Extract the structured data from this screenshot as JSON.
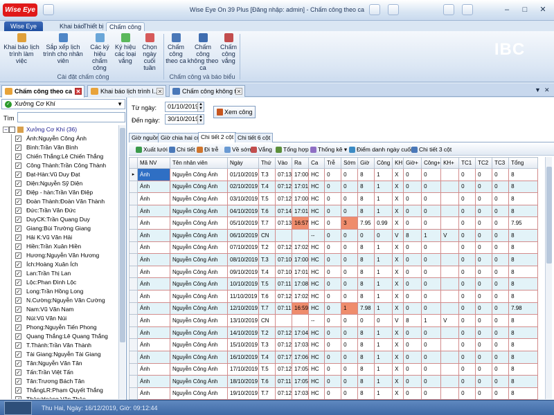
{
  "app": {
    "brand": "Wise Eye",
    "title": "Wise Eye On 39 Plus [Đăng nhập: admin] - Chấm công theo ca"
  },
  "menu": {
    "file": "Wise Eye",
    "tabs": [
      "Khai báo",
      "Thiết bị",
      "Chấm công"
    ]
  },
  "ribbon": {
    "group1": {
      "caption": "Cài đặt chấm công",
      "buttons": [
        {
          "label": "Khai báo lịch\ntrình làm\nviệc",
          "icon": "schedule-icon"
        },
        {
          "label": "Sắp xếp lịch\ntrình cho nhân\nviên",
          "icon": "arrange-icon"
        },
        {
          "label": "Các ký\nhiệu chấm\ncông",
          "icon": "symbol-icon"
        },
        {
          "label": "Ký hiệu\ncác loại\nvắng",
          "icon": "absence-icon"
        },
        {
          "label": "Chọn\nngày cuối\ntuần",
          "icon": "weekend-icon"
        }
      ]
    },
    "group2": {
      "caption": "Chấm công và báo biểu",
      "buttons": [
        {
          "label": "Chấm\ncông\ntheo ca",
          "icon": "shift-icon"
        },
        {
          "label": "Chấm công\nkhông theo\nca",
          "icon": "noshift-icon"
        },
        {
          "label": "Chấm\ncông\nvắng",
          "icon": "absent-icon"
        }
      ]
    },
    "brand_logo": {
      "big": "IBC",
      "small": "Smart Lock"
    }
  },
  "doc_tabs": [
    {
      "label": "Chấm công theo ca"
    },
    {
      "label": "Khai báo lịch trình l..."
    },
    {
      "label": "Chấm công không t..."
    }
  ],
  "left_panel": {
    "combo": "Xưởng Cơ Khí",
    "search_label": "Tìm",
    "search_value": "",
    "root": "Xưởng Cơ Khí (36)",
    "employees": [
      "Ánh:Nguyễn Công Ánh",
      "Bình:Trần Văn Bình",
      "Chiến Thắng:Lê Chiến Thắng",
      "Công Thành:Trần Công Thành",
      "Đạt-Hàn:Vũ Duy Đạt",
      "Diện:Nguyễn Sỹ Diện",
      "Điệp - hàn:Trần Văn Điệp",
      "Đoàn Thành:Đoàn Văn Thành",
      "Đức:Trần Văn Đức",
      "DuyCK:Trần Quang Duy",
      "Giang:Bùi Trường Giang",
      "Hải K:Vũ Văn Hải",
      "Hiền:Trần Xuân Hiền",
      "Hương:Nguyễn Văn Hương",
      "Ích:Hoàng Xuân Ích",
      "Lan:Trần Thị Lan",
      "Lộc:Phan Đình Lộc",
      "Long:Trần Hồng Long",
      "N.Cường:Nguyễn Văn Cường",
      "Nam:Vũ Văn Nam",
      "Núi:Vũ Văn Núi",
      "Phong:Nguyễn Tiến Phong",
      "Quang Thắng:Lê Quang Thắng",
      "T.Thành:Trần Văn Thành",
      "Tài Giang:Nguyễn Tài Giang",
      "Tân:Nguyễn Văn Tân",
      "Tấn:Trần Việt Tấn",
      "Tân:Trương Bách Tân",
      "ThắngLR:Phạm Quyết Thắng",
      "Thảo:Hoàng Văn Thảo",
      "Thủy:Nguyễn Xuân Thủy"
    ]
  },
  "filters": {
    "from_label": "Từ ngày:",
    "from_value": "01/10/2019",
    "to_label": "Đến ngày:",
    "to_value": "30/10/2019",
    "view_button": "Xem công"
  },
  "sub_tabs": [
    "Giờ nguồn",
    "Giờ chia hai cột",
    "Chi tiết 2 cột",
    "Chi tiết 6 cột"
  ],
  "toolbar": [
    "Xuất lưới",
    "Chi tiết",
    "Đi trễ",
    "Về sớm",
    "Vắng",
    "Tổng hợp",
    "Thống kê",
    "Điểm danh ngày cuối",
    "Chi tiết 3 cột"
  ],
  "table": {
    "columns": [
      "Mã NV",
      "Tên nhân viên",
      "Ngày",
      "Thứ",
      "Vào",
      "Ra",
      "Ca",
      "Trễ",
      "Sớm",
      "Giờ",
      "Công",
      "KH",
      "Giờ+",
      "Công+",
      "KH+",
      "TC1",
      "TC2",
      "TC3",
      "Tổng"
    ],
    "rows": [
      [
        "Ánh",
        "Nguyễn Công Ánh",
        "01/10/2019",
        "T.3",
        "07:13",
        "17:00",
        "HC",
        "0",
        "0",
        "8",
        "1",
        "X",
        "0",
        "0",
        "",
        "0",
        "0",
        "0",
        "8"
      ],
      [
        "Ánh",
        "Nguyễn Công Ánh",
        "02/10/2019",
        "T.4",
        "07:12",
        "17:01",
        "HC",
        "0",
        "0",
        "8",
        "1",
        "X",
        "0",
        "0",
        "",
        "0",
        "0",
        "0",
        "8"
      ],
      [
        "Ánh",
        "Nguyễn Công Ánh",
        "03/10/2019",
        "T.5",
        "07:12",
        "17:00",
        "HC",
        "0",
        "0",
        "8",
        "1",
        "X",
        "0",
        "0",
        "",
        "0",
        "0",
        "0",
        "8"
      ],
      [
        "Ánh",
        "Nguyễn Công Ánh",
        "04/10/2019",
        "T.6",
        "07:14",
        "17:01",
        "HC",
        "0",
        "0",
        "8",
        "1",
        "X",
        "0",
        "0",
        "",
        "0",
        "0",
        "0",
        "8"
      ],
      [
        "Ánh",
        "Nguyễn Công Ánh",
        "05/10/2019",
        "T.7",
        "07:13",
        "16:57",
        "HC",
        "0",
        "3",
        "7.95",
        "0.99",
        "X",
        "0",
        "0",
        "",
        "0",
        "0",
        "0",
        "7.95"
      ],
      [
        "Ánh",
        "Nguyễn Công Ánh",
        "06/10/2019",
        "CN",
        "",
        "",
        "--",
        "0",
        "0",
        "0",
        "0",
        "V",
        "8",
        "1",
        "V",
        "0",
        "0",
        "0",
        "8"
      ],
      [
        "Ánh",
        "Nguyễn Công Ánh",
        "07/10/2019",
        "T.2",
        "07:12",
        "17:02",
        "HC",
        "0",
        "0",
        "8",
        "1",
        "X",
        "0",
        "0",
        "",
        "0",
        "0",
        "0",
        "8"
      ],
      [
        "Ánh",
        "Nguyễn Công Ánh",
        "08/10/2019",
        "T.3",
        "07:10",
        "17:00",
        "HC",
        "0",
        "0",
        "8",
        "1",
        "X",
        "0",
        "0",
        "",
        "0",
        "0",
        "0",
        "8"
      ],
      [
        "Ánh",
        "Nguyễn Công Ánh",
        "09/10/2019",
        "T.4",
        "07:10",
        "17:01",
        "HC",
        "0",
        "0",
        "8",
        "1",
        "X",
        "0",
        "0",
        "",
        "0",
        "0",
        "0",
        "8"
      ],
      [
        "Ánh",
        "Nguyễn Công Ánh",
        "10/10/2019",
        "T.5",
        "07:11",
        "17:08",
        "HC",
        "0",
        "0",
        "8",
        "1",
        "X",
        "0",
        "0",
        "",
        "0",
        "0",
        "0",
        "8"
      ],
      [
        "Ánh",
        "Nguyễn Công Ánh",
        "11/10/2019",
        "T.6",
        "07:12",
        "17:02",
        "HC",
        "0",
        "0",
        "8",
        "1",
        "X",
        "0",
        "0",
        "",
        "0",
        "0",
        "0",
        "8"
      ],
      [
        "Ánh",
        "Nguyễn Công Ánh",
        "12/10/2019",
        "T.7",
        "07:11",
        "16:59",
        "HC",
        "0",
        "1",
        "7.98",
        "1",
        "X",
        "0",
        "0",
        "",
        "0",
        "0",
        "0",
        "7.98"
      ],
      [
        "Ánh",
        "Nguyễn Công Ánh",
        "13/10/2019",
        "CN",
        "",
        "",
        "--",
        "0",
        "0",
        "0",
        "0",
        "V",
        "8",
        "1",
        "V",
        "0",
        "0",
        "0",
        "8"
      ],
      [
        "Ánh",
        "Nguyễn Công Ánh",
        "14/10/2019",
        "T.2",
        "07:12",
        "17:04",
        "HC",
        "0",
        "0",
        "8",
        "1",
        "X",
        "0",
        "0",
        "",
        "0",
        "0",
        "0",
        "8"
      ],
      [
        "Ánh",
        "Nguyễn Công Ánh",
        "15/10/2019",
        "T.3",
        "07:12",
        "17:03",
        "HC",
        "0",
        "0",
        "8",
        "1",
        "X",
        "0",
        "0",
        "",
        "0",
        "0",
        "0",
        "8"
      ],
      [
        "Ánh",
        "Nguyễn Công Ánh",
        "16/10/2019",
        "T.4",
        "07:17",
        "17:06",
        "HC",
        "0",
        "0",
        "8",
        "1",
        "X",
        "0",
        "0",
        "",
        "0",
        "0",
        "0",
        "8"
      ],
      [
        "Ánh",
        "Nguyễn Công Ánh",
        "17/10/2019",
        "T.5",
        "07:12",
        "17:05",
        "HC",
        "0",
        "0",
        "8",
        "1",
        "X",
        "0",
        "0",
        "",
        "0",
        "0",
        "0",
        "8"
      ],
      [
        "Ánh",
        "Nguyễn Công Ánh",
        "18/10/2019",
        "T.6",
        "07:11",
        "17:05",
        "HC",
        "0",
        "0",
        "8",
        "1",
        "X",
        "0",
        "0",
        "",
        "0",
        "0",
        "0",
        "8"
      ],
      [
        "Ánh",
        "Nguyễn Công Ánh",
        "19/10/2019",
        "T.7",
        "07:12",
        "17:03",
        "HC",
        "0",
        "0",
        "8",
        "1",
        "X",
        "0",
        "0",
        "",
        "0",
        "0",
        "0",
        "8"
      ]
    ],
    "highlight": [
      {
        "row": 4,
        "cols": [
          5,
          8
        ]
      },
      {
        "row": 11,
        "cols": [
          5,
          8
        ]
      }
    ],
    "colors": {
      "selected": "#2f6fc4",
      "highlight": "#ef8c6c",
      "alt_row": "#e3f3f8"
    }
  },
  "status": {
    "text": "Thu Hai, Ngày: 16/12/2019, Giờ: 09:12:44"
  }
}
